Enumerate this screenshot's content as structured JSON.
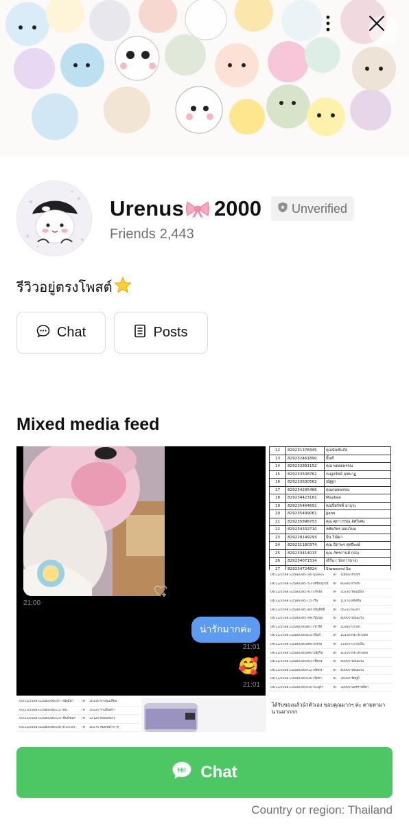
{
  "header": {
    "more_icon": "more-vertical-icon",
    "close_icon": "close-icon"
  },
  "profile": {
    "name": "Urenus",
    "name_emoji": "🎀",
    "name_suffix": "2000",
    "badge": "Unverified",
    "friends_label": "Friends",
    "friends_count": "2,443",
    "status_text": "รีวิวอยู่ตรงโพสต์",
    "status_emoji": "⭐"
  },
  "actions": {
    "chat_label": "Chat",
    "posts_label": "Posts"
  },
  "feed": {
    "title": "Mixed media feed",
    "chat_tile": {
      "time1": "21:00",
      "message": "น่ารักมากค่ะ",
      "time2": "21:01",
      "reply_emoji": "🥰",
      "time3": "21:01"
    },
    "table_tile": {
      "rows": [
        {
          "n": "12",
          "code": "829231378345",
          "name": "คุณนันท์นภัส"
        },
        {
          "n": "13",
          "code": "829232461890",
          "name": "มิ้นท์"
        },
        {
          "n": "14",
          "code": "829232891152",
          "name": "คุณ พลอยพรรณ"
        },
        {
          "n": "15",
          "code": "829233508762",
          "name": "เบญจรัตน์ นุชนาฏ"
        },
        {
          "n": "16",
          "code": "829233630562",
          "name": "ณัฐฐา"
        },
        {
          "n": "17",
          "code": "829234295466",
          "name": "คุณกมลพรรณ"
        },
        {
          "n": "18",
          "code": "829234423161",
          "name": "Maybee"
        },
        {
          "n": "19",
          "code": "829235464691",
          "name": "คุณปิยรัชต์ มาธุระ"
        },
        {
          "n": "20",
          "code": "829235499061",
          "name": "Jjane"
        },
        {
          "n": "21",
          "code": "829235896753",
          "name": "คุณ ศุภาวรรณ อัศวิเศษ"
        },
        {
          "n": "22",
          "code": "829234332710",
          "name": "หทัยภัทร อ่อนโนน"
        },
        {
          "n": "23",
          "code": "829228149293",
          "name": "มีน วิณิดา"
        },
        {
          "n": "24",
          "code": "829231180374",
          "name": "คุณ ธิดาพร สุทธิพงษ์"
        },
        {
          "n": "25",
          "code": "829233414015",
          "name": "คุณ ภัทรกานต์ (ปอ)"
        },
        {
          "n": "26",
          "code": "829234071514",
          "name": "เอ็ร์น ( นักการบาง)"
        },
        {
          "n": "27",
          "code": "829234724824",
          "name": "Siwapond Sa"
        }
      ]
    },
    "ship_tile": {
      "rows": [
        {
          "d": "04/12/2568 14:32",
          "t": "ED580285740TH",
          "nm": "paesa",
          "cc": "TH",
          "z": "10600",
          "pr": "ส้าเหร่"
        },
        {
          "d": "04/12/2568 14:33",
          "t": "ED580285753TH",
          "nm": "ศรัณญาณ์",
          "cc": "TH",
          "z": "80280",
          "pr": "ท่าพระ"
        },
        {
          "d": "04/12/2568 14:33",
          "t": "ED580285767TH",
          "nm": "ภัทรธ",
          "cc": "TH",
          "z": "10230",
          "pr": "รอนเมือง"
        },
        {
          "d": "04/12/2568 14:33",
          "t": "ED580285775TH",
          "nm": "ริน",
          "cc": "TH",
          "z": "10170",
          "pr": "ตลิ่งชัน"
        },
        {
          "d": "04/12/2568 14:34",
          "t": "ED580285784TH",
          "nm": "ธัญสิทธิ์",
          "cc": "TH",
          "z": "56210",
          "pr": "พะเยา"
        },
        {
          "d": "04/12/2568 14:34",
          "t": "ED580285798TH",
          "nm": "นิ่มนุ่ม",
          "cc": "TH",
          "z": "40000",
          "pr": "ขอนแก่น"
        },
        {
          "d": "04/12/2568 14:35",
          "t": "ED580285807TH",
          "nm": "ชาร์ลี",
          "cc": "TH",
          "z": "10280",
          "pr": "บางนา"
        },
        {
          "d": "04/12/2568 14:35",
          "t": "ED580285815TH",
          "nm": "พิมพ์",
          "cc": "TH",
          "z": "10130",
          "pr": "พระประแดง"
        },
        {
          "d": "04/12/2568 14:44",
          "t": "ED580285886TH",
          "nm": "พรรษ",
          "cc": "TH",
          "z": "13160",
          "pr": "บางปะอิน"
        },
        {
          "d": "04/12/2568 14:44",
          "t": "ED580285890TH",
          "nm": "ณัฐริน",
          "cc": "TH",
          "z": "10150",
          "pr": "พระประแดง"
        },
        {
          "d": "04/12/2568 14:45",
          "t": "ED580285903TH",
          "nm": "ชิดพร",
          "cc": "TH",
          "z": "40000",
          "pr": "ขอนแก่น"
        },
        {
          "d": "04/12/2568 14:45",
          "t": "ED580285912TH",
          "nm": "สัดพร",
          "cc": "TH",
          "z": "40000",
          "pr": "ขอนแก่น"
        },
        {
          "d": "04/12/2568 14:46",
          "t": "ED580285926TH",
          "nm": "จิตรา",
          "cc": "TH",
          "z": "36000",
          "pr": "ชัยภูมิ"
        },
        {
          "d": "04/12/2568 14:46",
          "t": "ED580285930TH",
          "nm": "มะยุรา",
          "cc": "TH",
          "z": "30000",
          "pr": "นครราชสีมา"
        }
      ]
    },
    "strip_tile": {
      "rows": [
        {
          "d": "05/12/2568 13:36",
          "t": "ED580286507TH",
          "nm": "ณัฐธิดา",
          "cc": "TH",
          "z": "10150",
          "pr": "บางขุนเทียน"
        },
        {
          "d": "05/12/2568 13:36",
          "t": "ED580286515TH",
          "nm": "ฝน",
          "cc": "TH",
          "z": "10220",
          "pr": "รามอินทรา"
        },
        {
          "d": "05/12/2568 13:37",
          "t": "ED580286524TH",
          "nm": "พิมพ์ชนก",
          "cc": "TH",
          "z": "12120",
          "pr": "คลองหลวง"
        },
        {
          "d": "05/12/2568 13:38",
          "t": "ED580286538TH",
          "nm": "Hunnes",
          "cc": "TH",
          "z": "10270",
          "pr": "สมุทรปราการ"
        }
      ]
    },
    "note_tile": {
      "text": "ได้รับของแล้วน้าตัวเอง ขอบคุณมากๆ ค่ะ ตามหามานานมากกก"
    }
  },
  "footer": {
    "chat_label": "Chat",
    "chat_icon_text": "Hi!",
    "region_label": "Country or region:",
    "region_value": "Thailand"
  },
  "colors": {
    "line_green": "#4cc764",
    "bubble_blue": "#5b9cf2"
  }
}
